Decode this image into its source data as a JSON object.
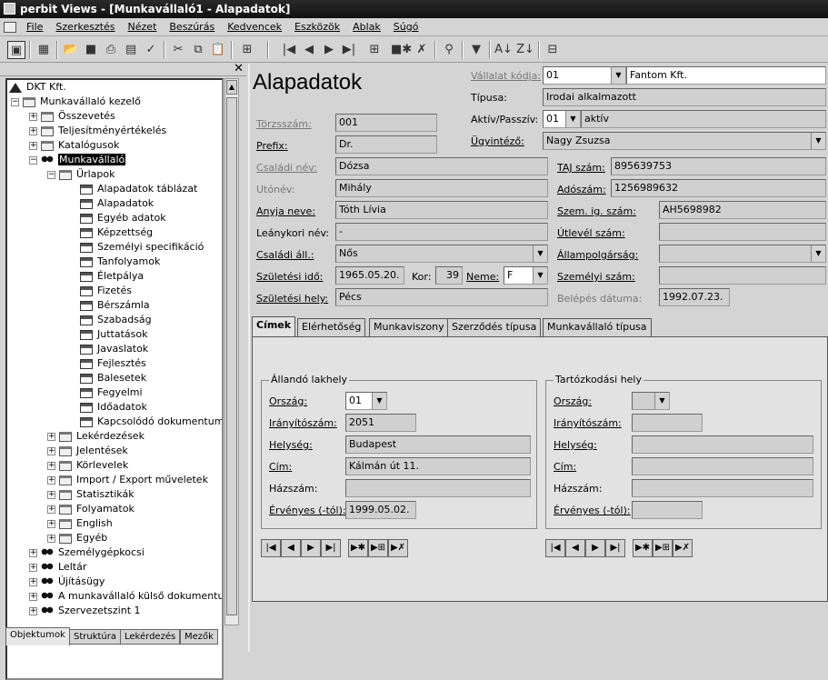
{
  "window": {
    "title": "perbit Views - [Munkavállaló1 - Alapadatok]"
  },
  "menu": [
    "File",
    "Szerkesztés",
    "Nézet",
    "Beszúrás",
    "Kedvencek",
    "Eszközök",
    "Ablak",
    "Súgó"
  ],
  "tree": {
    "root": "DKT Kft.",
    "items": [
      {
        "label": "Munkavállaló kezelő"
      },
      {
        "label": "Összevetés"
      },
      {
        "label": "Teljesítményértékelés"
      },
      {
        "label": "Katalógusok"
      },
      {
        "label": "Munkavállaló"
      },
      {
        "label": "Űrlapok"
      },
      {
        "label": "Alapadatok táblázat"
      },
      {
        "label": "Alapadatok"
      },
      {
        "label": "Egyéb adatok"
      },
      {
        "label": "Képzettség"
      },
      {
        "label": "Személyi specifikáció"
      },
      {
        "label": "Tanfolyamok"
      },
      {
        "label": "Életpálya"
      },
      {
        "label": "Fizetés"
      },
      {
        "label": "Bérszámla"
      },
      {
        "label": "Szabadság"
      },
      {
        "label": "Juttatások"
      },
      {
        "label": "Javaslatok"
      },
      {
        "label": "Fejlesztés"
      },
      {
        "label": "Balesetek"
      },
      {
        "label": "Fegyelmi"
      },
      {
        "label": "Időadatok"
      },
      {
        "label": "Kapcsolódó dokumentumok"
      },
      {
        "label": "Lekérdezések"
      },
      {
        "label": "Jelentések"
      },
      {
        "label": "Körlevelek"
      },
      {
        "label": "Import / Export műveletek"
      },
      {
        "label": "Statisztikák"
      },
      {
        "label": "Folyamatok"
      },
      {
        "label": "English"
      },
      {
        "label": "Egyéb"
      },
      {
        "label": "Személygépkocsi"
      },
      {
        "label": "Leltár"
      },
      {
        "label": "Újításügy"
      },
      {
        "label": "A munkavállaló külső dokumentumai"
      },
      {
        "label": "Szervezetszint 1"
      }
    ]
  },
  "bottom_tabs": [
    "Objektumok",
    "Struktúra",
    "Lekérdezés",
    "Mezők"
  ],
  "form": {
    "heading": "Alapadatok",
    "company_code_label": "Vállalat kódja:",
    "company_code": "01",
    "company_name": "Fantom Kft.",
    "type_label": "Típusa:",
    "type": "Irodai alkalmazott",
    "active_label": "Aktív/Passzív:",
    "active_code": "01",
    "active_value": "aktív",
    "admin_label": "Ügyintéző:",
    "admin": "Nagy Zsuzsa",
    "torzsszam_label": "Törzsszám:",
    "torzsszam": "001",
    "prefix_label": "Prefix:",
    "prefix": "Dr.",
    "family_label": "Családi név:",
    "family": "Dózsa",
    "given_label": "Utónév:",
    "given": "Mihály",
    "mother_label": "Anyja neve:",
    "mother": "Tóth Lívia",
    "maiden_label": "Leánykori név:",
    "maiden": "-",
    "marital_label": "Családi áll.:",
    "marital": "Nős",
    "birthdate_label": "Születési idő:",
    "birthdate": "1965.05.20.",
    "age_label": "Kor:",
    "age": "39",
    "gender_label": "Neme:",
    "gender": "F",
    "birthplace_label": "Születési hely:",
    "birthplace": "Pécs",
    "taj_label": "TAJ szám:",
    "taj": "895639753",
    "tax_label": "Adószám:",
    "tax": "1256989632",
    "id_label": "Szem. ig. szám:",
    "id": "AH5698982",
    "passport_label": "Útlevél szám:",
    "citizenship_label": "Állampolgárság:",
    "personal_label": "Személyi szám:",
    "entry_label": "Belépés dátuma:",
    "entry": "1992.07.23."
  },
  "tabs": [
    "Címek",
    "Elérhetőség",
    "Munkaviszony",
    "Szerződés típusa",
    "Munkavállaló típusa"
  ],
  "address_perm": {
    "title": "Állandó lakhely",
    "country_label": "Ország:",
    "country": "01",
    "zip_label": "Irányítószám:",
    "zip": "2051",
    "city_label": "Helység:",
    "city": "Budapest",
    "street_label": "Cím:",
    "street": "Kálmán út 11.",
    "house_label": "Házszám:",
    "valid_label": "Érvényes (-tól):",
    "valid": "1999.05.02."
  },
  "address_temp": {
    "title": "Tartózkodási hely",
    "country_label": "Ország:",
    "zip_label": "Irányítószám:",
    "city_label": "Helység:",
    "street_label": "Cím:",
    "house_label": "Házszám:",
    "valid_label": "Érvényes (-tól):"
  },
  "nav_glyphs": [
    "|◀",
    "◀",
    "▶",
    "▶|",
    "▶✱",
    "▶⊞",
    "▶✗"
  ]
}
